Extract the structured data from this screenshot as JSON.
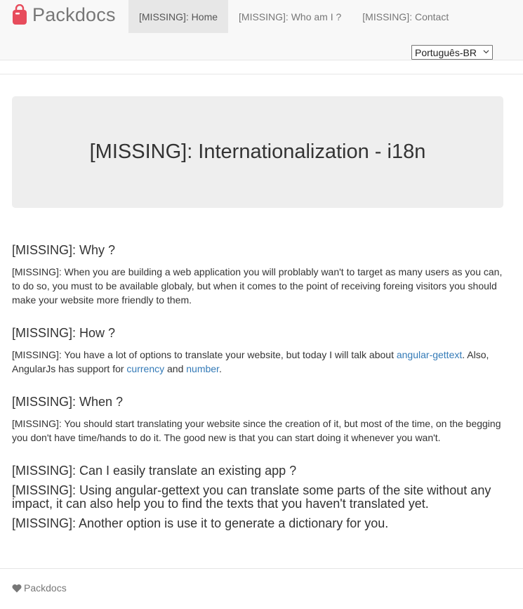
{
  "brand": {
    "name": "Packdocs",
    "icon": "bag-icon",
    "color": "#e74c5c"
  },
  "nav": {
    "items": [
      {
        "label": "[MISSING]: Home",
        "active": true
      },
      {
        "label": "[MISSING]: Who am I ?",
        "active": false
      },
      {
        "label": "[MISSING]: Contact",
        "active": false
      }
    ]
  },
  "language": {
    "selected": "Português-BR"
  },
  "jumbotron": {
    "title": "[MISSING]: Internationalization - i18n"
  },
  "sections": {
    "why": {
      "title": "[MISSING]: Why ?",
      "text": "[MISSING]: When you are building a web application you will problably wan't to target as many users as you can, to do so, you must to be available globaly, but when it comes to the point of receiving foreing visitors you should make your website more friendly to them."
    },
    "how": {
      "title": "[MISSING]: How ?",
      "text_before": "[MISSING]: You have a lot of options to translate your website, but today I will talk about ",
      "link_gettext": "angular-gettext",
      "text_middle": ". Also, AngularJs has support for ",
      "link_currency": "currency",
      "text_and": " and ",
      "link_number": "number",
      "text_end": "."
    },
    "when": {
      "title": "[MISSING]: When ?",
      "text": "[MISSING]: You should start translating your website since the creation of it, but most of the time, on the begging you don't have time/hands to do it. The good new is that you can start doing it whenever you wan't."
    },
    "can": {
      "title": "[MISSING]: Can I easily translate an existing app ?",
      "text1": "[MISSING]: Using angular-gettext you can translate some parts of the site without any impact, it can also help you to find the texts that you haven't translated yet.",
      "text2": "[MISSING]: Another option is use it to generate a dictionary for you."
    }
  },
  "footer": {
    "label": "Packdocs",
    "icon": "heart-icon"
  },
  "colors": {
    "link": "#337ab7",
    "navbar_bg": "#f8f8f8",
    "jumbotron_bg": "#eeeeee"
  }
}
